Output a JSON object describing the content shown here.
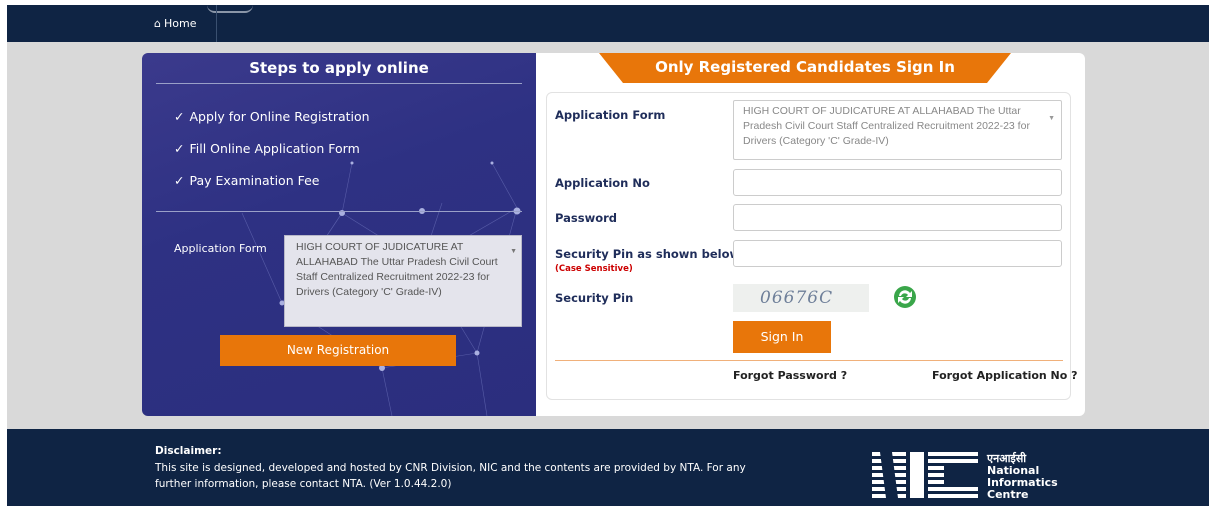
{
  "nav": {
    "home_label": "Home",
    "home_icon": "home-icon"
  },
  "left": {
    "title": "Steps to apply online",
    "steps": [
      "Apply for Online Registration",
      "Fill Online Application Form",
      "Pay Examination Fee"
    ],
    "form_label": "Application Form",
    "form_value": "HIGH COURT OF JUDICATURE AT ALLAHABAD The Uttar Pradesh Civil Court Staff Centralized Recruitment 2022-23 for Drivers (Category 'C' Grade-IV)",
    "new_registration": "New Registration"
  },
  "right": {
    "title": "Only Registered Candidates Sign In",
    "application_form_label": "Application Form",
    "application_form_value": "HIGH COURT OF JUDICATURE AT ALLAHABAD The Uttar Pradesh Civil Court Staff Centralized Recruitment 2022-23 for Drivers (Category 'C' Grade-IV)",
    "application_no_label": "Application No",
    "application_no_value": "",
    "password_label": "Password",
    "password_value": "",
    "security_pin_prompt": "Security Pin as shown below",
    "case_sensitive": "(Case Sensitive)",
    "security_pin_value": "",
    "security_pin_label": "Security Pin",
    "captcha_text": "06676C",
    "sign_in": "Sign In",
    "forgot_password": "Forgot Password ?",
    "forgot_application_no": "Forgot Application No ?"
  },
  "footer": {
    "disclaimer_heading": "Disclaimer:",
    "disclaimer_text": "This site is designed, developed and hosted by CNR Division, NIC and the contents are provided by NTA. For any further information, please contact NTA. (Ver 1.0.44.2.0)",
    "nic_hindi": "एनआईसी",
    "nic_line1": "National",
    "nic_line2": "Informatics",
    "nic_line3": "Centre"
  },
  "colors": {
    "navy": "#0f2444",
    "panel": "#2e3183",
    "accent": "#e8760a",
    "label": "#1f2d5a"
  }
}
